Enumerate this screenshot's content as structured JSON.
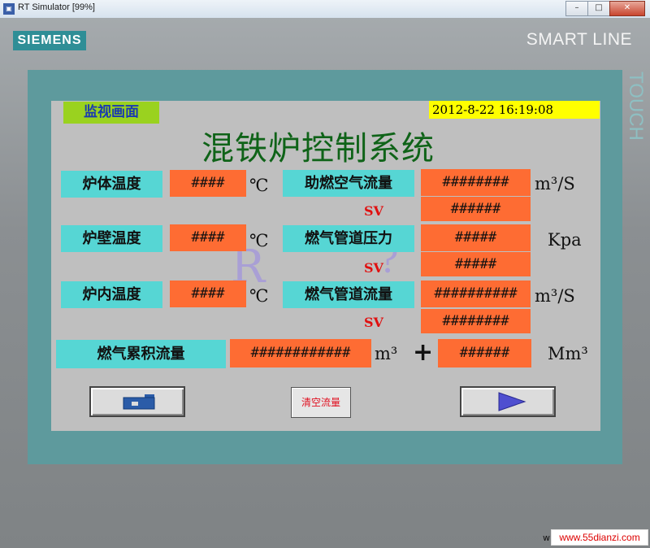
{
  "window": {
    "title": "RT Simulator [99%]",
    "minimize": "–",
    "maximize": "□",
    "close": "✕"
  },
  "device": {
    "brand": "SIEMENS",
    "model": "SMART LINE",
    "touch": "TOUCH"
  },
  "screen": {
    "tag": "监视画面",
    "datetime": "2012-8-22 16:19:08",
    "title": "混铁炉控制系统",
    "watermark_left": "R",
    "watermark_right": "?",
    "left_rows": [
      {
        "label": "炉体温度",
        "value": "####",
        "unit": "℃"
      },
      {
        "label": "炉壁温度",
        "value": "####",
        "unit": "℃"
      },
      {
        "label": "炉内温度",
        "value": "####",
        "unit": "℃"
      }
    ],
    "right_rows": [
      {
        "label": "助燃空气流量",
        "pv": "########",
        "sv_label": "SV",
        "sv": "######",
        "unit": "m³/S"
      },
      {
        "label": "燃气管道压力",
        "pv": "#####",
        "sv_label": "SV",
        "sv": "#####",
        "unit": "Kpa"
      },
      {
        "label": "燃气管道流量",
        "pv": "##########",
        "sv_label": "SV",
        "sv": "########",
        "unit": "m³/S"
      }
    ],
    "accumulated": {
      "label": "燃气累积流量",
      "value": "############",
      "unit": "m³",
      "plus": "+",
      "value2": "######",
      "unit2": "Mm³"
    },
    "buttons": {
      "clear_flow": "清空流量"
    }
  },
  "footer": {
    "prefix": "w",
    "site": "www.55dianzi.com"
  },
  "colors": {
    "label_bg": "#56d6d4",
    "value_bg": "#fe6c33",
    "screen_bg": "#bfbfbf",
    "frame": "#5e9a9d"
  },
  "icons": {
    "home_button": "home-icon",
    "next_button": "arrow-right-icon"
  }
}
